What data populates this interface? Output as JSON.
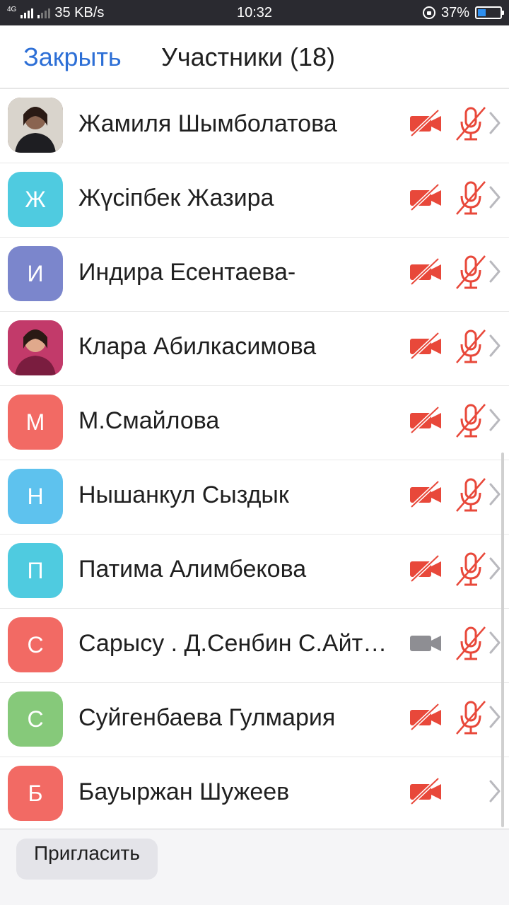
{
  "status_bar": {
    "network": "4G",
    "speed": "35 KB/s",
    "time": "10:32",
    "battery_percent": "37%",
    "battery_level": 0.37
  },
  "header": {
    "close_label": "Закрыть",
    "title": "Участники (18)"
  },
  "colors": {
    "accent": "#2d6fd6",
    "muted_red": "#e8483a",
    "video_on_gray": "#8e8e93"
  },
  "participants": [
    {
      "name": "Жамиля Шымболатова",
      "initial": "",
      "avatar_color": "#6b4a3c",
      "photo": true,
      "video_muted": true,
      "audio_muted": true,
      "show_mic": true
    },
    {
      "name": "Жүсіпбек Жазира",
      "initial": "Ж",
      "avatar_color": "#4fcbe0",
      "photo": false,
      "video_muted": true,
      "audio_muted": true,
      "show_mic": true
    },
    {
      "name": "Индира Есентаева-",
      "initial": "И",
      "avatar_color": "#7b86cc",
      "photo": false,
      "video_muted": true,
      "audio_muted": true,
      "show_mic": true
    },
    {
      "name": "Клара Абилкасимова",
      "initial": "",
      "avatar_color": "#b8324e",
      "photo": true,
      "video_muted": true,
      "audio_muted": true,
      "show_mic": true
    },
    {
      "name": "М.Смайлова",
      "initial": "М",
      "avatar_color": "#f26a64",
      "photo": false,
      "video_muted": true,
      "audio_muted": true,
      "show_mic": true
    },
    {
      "name": "Нышанкул Сыздык",
      "initial": "Н",
      "avatar_color": "#5ec2ee",
      "photo": false,
      "video_muted": true,
      "audio_muted": true,
      "show_mic": true
    },
    {
      "name": "Патима Алимбекова",
      "initial": "П",
      "avatar_color": "#4fcbe0",
      "photo": false,
      "video_muted": true,
      "audio_muted": true,
      "show_mic": true
    },
    {
      "name": "Сарысу . Д.Сенбин С.Айтмагамбетова",
      "initial": "С",
      "avatar_color": "#f26a64",
      "photo": false,
      "video_muted": false,
      "audio_muted": true,
      "show_mic": true
    },
    {
      "name": "Суйгенбаева Гулмария",
      "initial": "С",
      "avatar_color": "#86c97a",
      "photo": false,
      "video_muted": true,
      "audio_muted": true,
      "show_mic": true
    },
    {
      "name": "Бауыржан Шужеев",
      "initial": "Б",
      "avatar_color": "#f26a64",
      "photo": false,
      "video_muted": true,
      "audio_muted": false,
      "show_mic": false
    }
  ],
  "footer": {
    "invite_label": "Пригласить"
  }
}
